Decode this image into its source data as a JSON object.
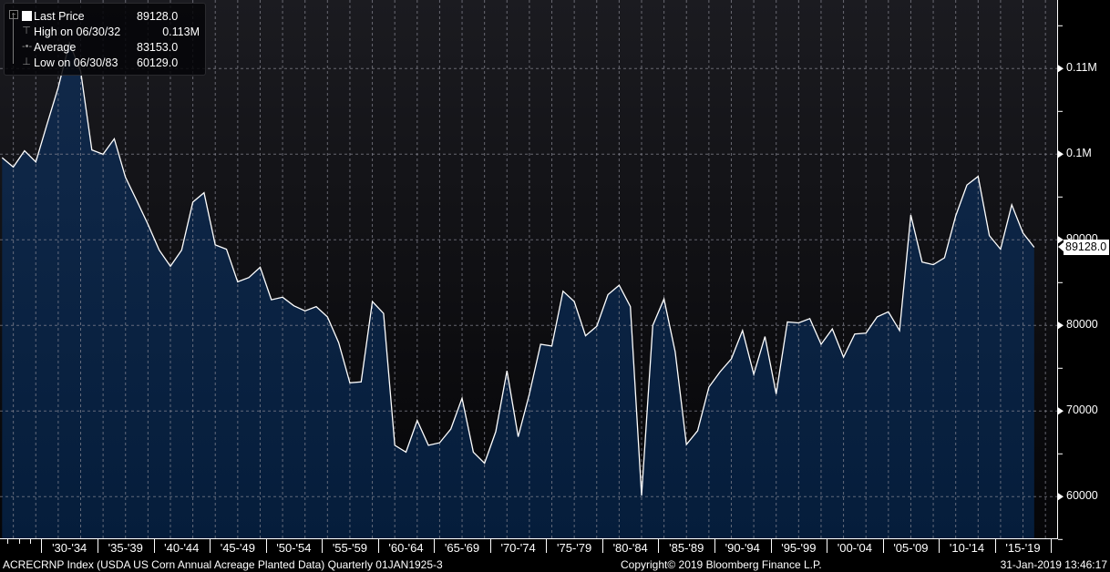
{
  "legend": {
    "last_price_label": "Last Price",
    "last_price_value": "89128.0",
    "high_label": "High on 06/30/32",
    "high_value": "0.113M",
    "average_label": "Average",
    "average_value": "83153.0",
    "low_label": "Low on 06/30/83",
    "low_value": "60129.0"
  },
  "last_price_tag": "89128.0",
  "footer": {
    "security": "ACRECRNP Index (USDA US Corn Annual Acreage Planted Data)  Quarterly 01JAN1925-3",
    "copyright": "Copyright© 2019 Bloomberg Finance L.P.",
    "timestamp": "31-Jan-2019 13:46:17"
  },
  "colors": {
    "line": "#ffffff",
    "fill_top": "#11294a",
    "fill_bottom": "#051d3b",
    "grid": "#8a8a95",
    "bg_top": "#1b1b20",
    "bg_bottom": "#050507"
  },
  "chart_data": {
    "type": "area",
    "title": "USDA US Corn Annual Acreage Planted Data",
    "x_start_year": 1926,
    "values": [
      99600,
      98500,
      100400,
      99100,
      103500,
      107800,
      113000,
      109700,
      100500,
      100000,
      101800,
      97300,
      94600,
      91800,
      88800,
      86900,
      88800,
      94400,
      95500,
      89400,
      88900,
      85100,
      85600,
      86800,
      83000,
      83300,
      82300,
      81700,
      82200,
      81000,
      78000,
      73300,
      73400,
      82800,
      81400,
      66000,
      65200,
      68900,
      66000,
      66300,
      67900,
      71500,
      65200,
      63900,
      67600,
      74700,
      67000,
      72000,
      77800,
      77600,
      84000,
      82800,
      78800,
      79900,
      83600,
      84700,
      82200,
      60129,
      80000,
      83100,
      76900,
      66100,
      67700,
      72800,
      74600,
      76100,
      79400,
      74300,
      78700,
      72000,
      80400,
      80300,
      80800,
      77800,
      79600,
      76300,
      79000,
      79100,
      81000,
      81600,
      79400,
      92900,
      87400,
      87100,
      87900,
      92800,
      96400,
      97400,
      90500,
      88900,
      94100,
      90800,
      89128
    ],
    "y_ticks": [
      {
        "value": 110000,
        "label": "0.11M"
      },
      {
        "value": 100000,
        "label": "0.1M"
      },
      {
        "value": 90000,
        "label": "90000"
      },
      {
        "value": 80000,
        "label": "80000"
      },
      {
        "value": 70000,
        "label": "70000"
      },
      {
        "value": 60000,
        "label": "60000"
      }
    ],
    "x_tick_labels": [
      "'30-'34",
      "'35-'39",
      "'40-'44",
      "'45-'49",
      "'50-'54",
      "'55-'59",
      "'60-'64",
      "'65-'69",
      "'70-'74",
      "'75-'79",
      "'80-'84",
      "'85-'89",
      "'90-'94",
      "'95-'99",
      "'00-'04",
      "'05-'09",
      "'10-'14",
      "'15-'19"
    ],
    "ylim": [
      55200,
      118000
    ],
    "grid": true,
    "legend_position": "top-left"
  }
}
